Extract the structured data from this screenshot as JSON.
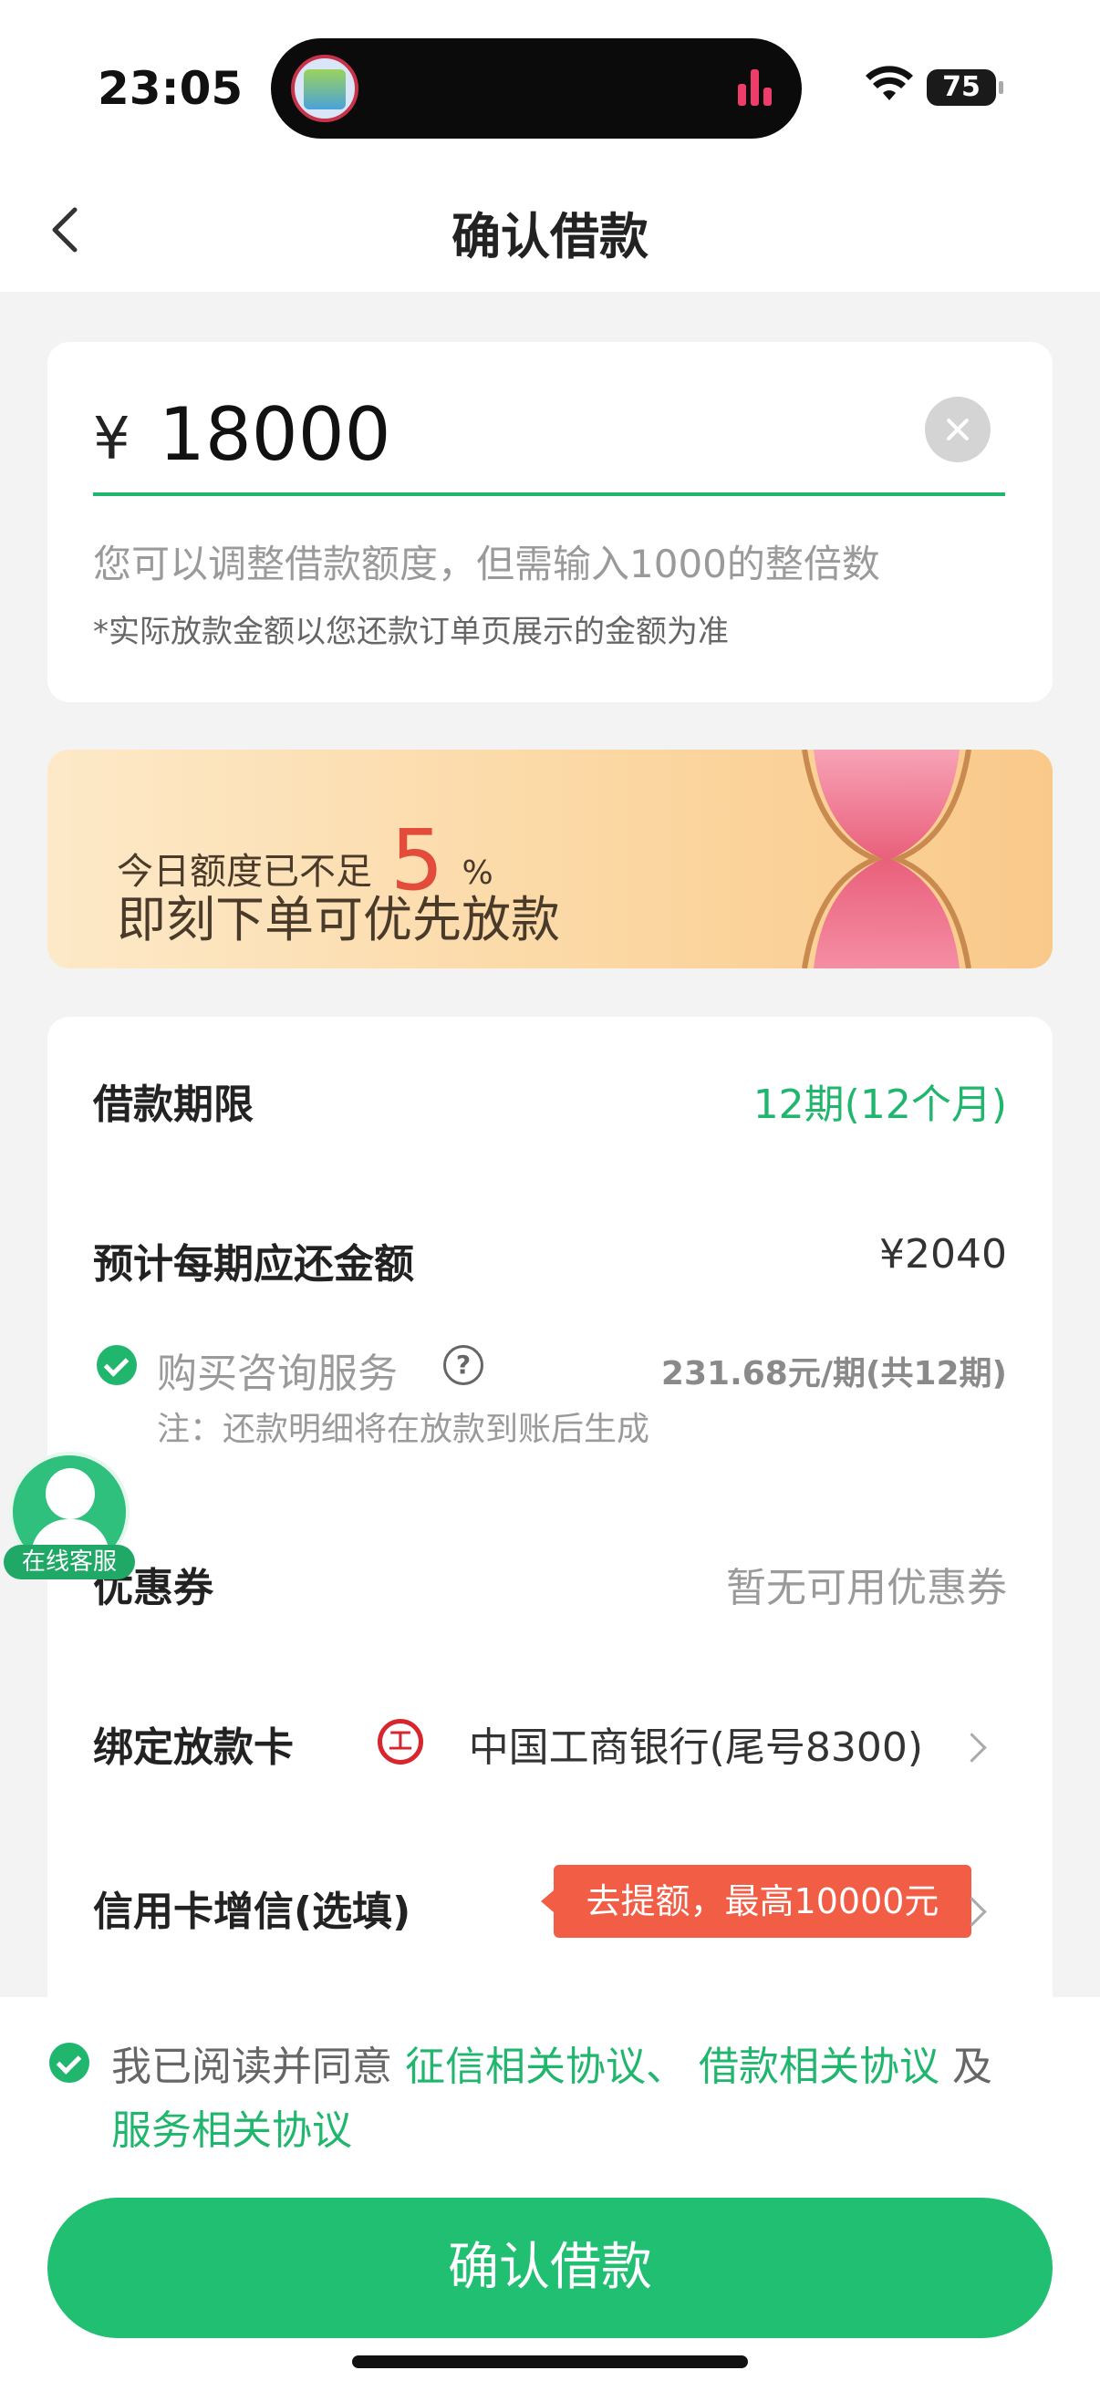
{
  "status_bar": {
    "time": "23:05",
    "battery": "75"
  },
  "header": {
    "title": "确认借款"
  },
  "amount_card": {
    "currency": "¥",
    "amount": "18000",
    "hint": "您可以调整借款额度，但需输入1000的整倍数",
    "note": "*实际放款金额以您还款订单页展示的金额为准"
  },
  "banner": {
    "line1_prefix": "今日额度已不足",
    "percent": "5",
    "percent_unit": "%",
    "line2": "即刻下单可优先放款"
  },
  "details": {
    "term_label": "借款期限",
    "term_value": "12期(12个月)",
    "monthly_label": "预计每期应还金额",
    "monthly_value": "¥2040",
    "service_label": "购买咨询服务",
    "service_value": "231.68元/期(共12期)",
    "service_note": "注：还款明细将在放款到账后生成",
    "coupon_label": "优惠券",
    "coupon_value": "暂无可用优惠券",
    "card_label": "绑定放款卡",
    "card_value": "中国工商银行(尾号8300)",
    "credit_label": "信用卡增信(选填)",
    "credit_promo": "去提额，最高10000元"
  },
  "customer_service": {
    "label": "在线客服"
  },
  "agreement": {
    "prefix": "我已阅读并同意",
    "link1": "征信相关协议、",
    "link2": "借款相关协议",
    "and": "及",
    "link3": "服务相关协议"
  },
  "confirm_button": {
    "label": "确认借款"
  },
  "colors": {
    "accent_green": "#20b66e",
    "promo_red": "#f25d46",
    "percent_red": "#e34b3a"
  }
}
